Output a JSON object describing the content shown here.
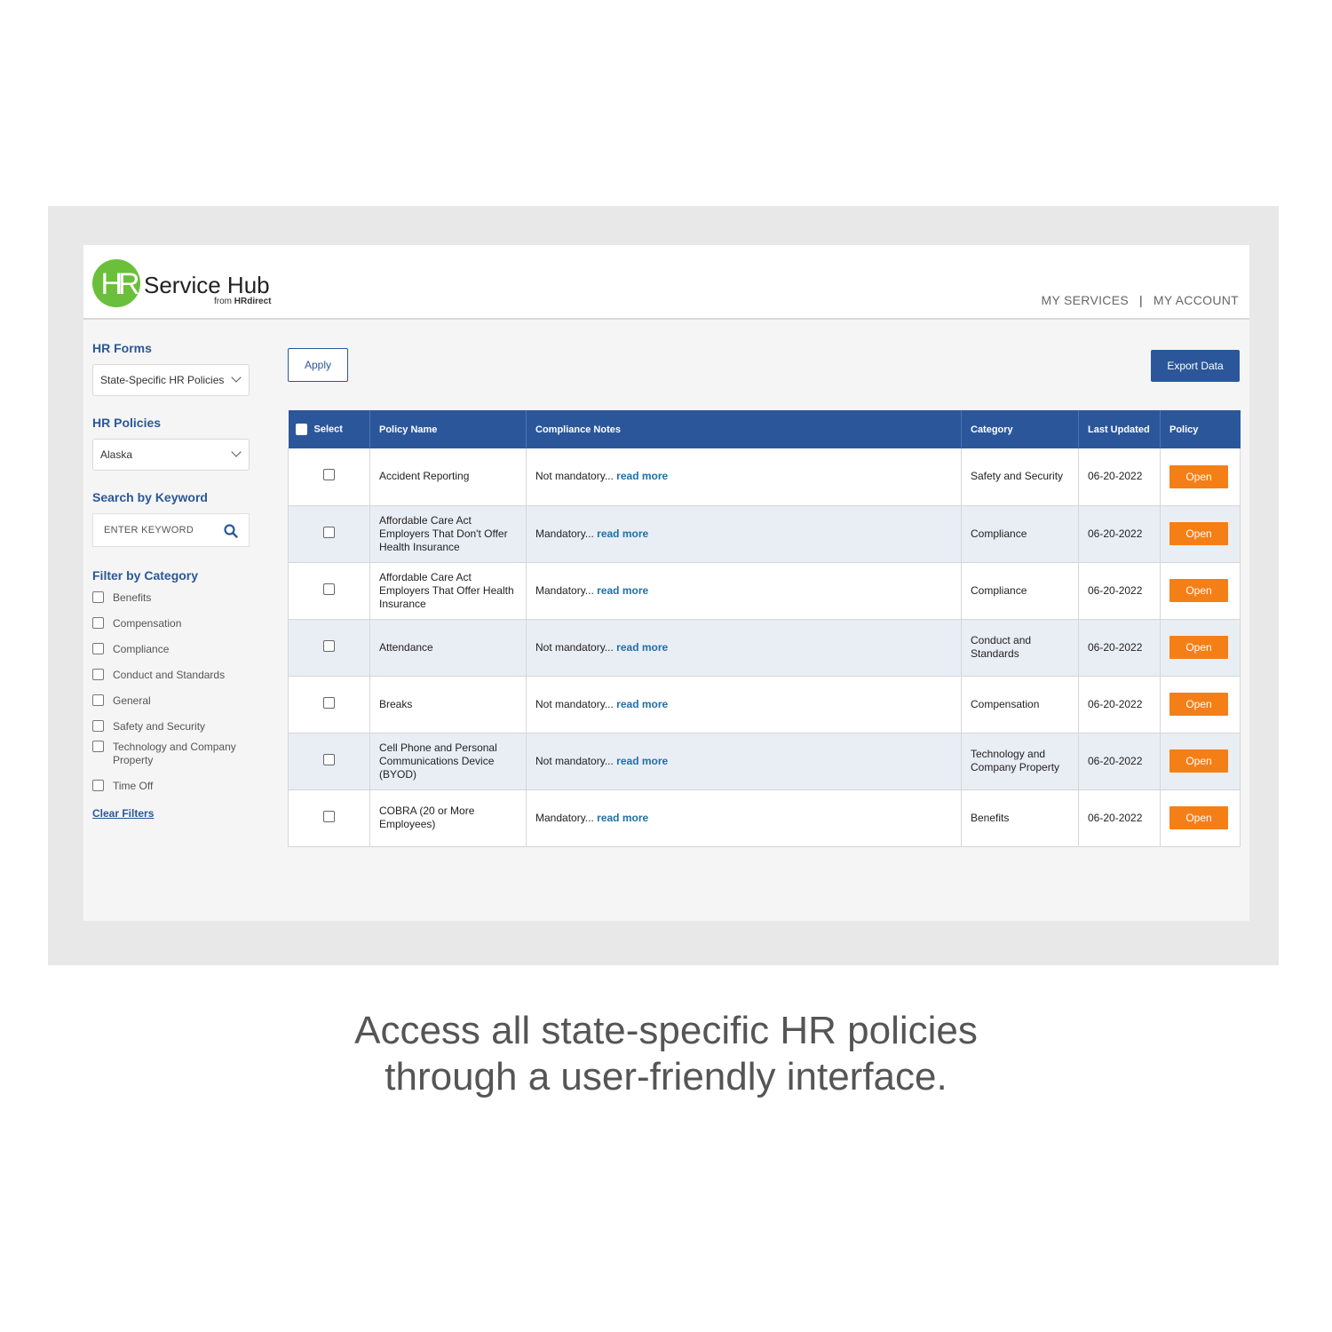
{
  "header": {
    "logo_mark": "HR",
    "logo_title": "Service Hub",
    "logo_sub_from": "from ",
    "logo_sub_brand": "HRdirect",
    "nav": [
      "MY SERVICES",
      "MY ACCOUNT"
    ],
    "nav_separator": "|"
  },
  "sidebar": {
    "hr_forms_label": "HR Forms",
    "hr_forms_value": "State-Specific HR Policies",
    "hr_policies_label": "HR Policies",
    "hr_policies_value": "Alaska",
    "search_label": "Search by Keyword",
    "search_placeholder": "ENTER KEYWORD",
    "filter_label": "Filter by Category",
    "categories": [
      "Benefits",
      "Compensation",
      "Compliance",
      "Conduct and Standards",
      "General",
      "Safety and Security",
      "Technology and Company Property",
      "Time Off"
    ],
    "clear_filters": "Clear Filters"
  },
  "toolbar": {
    "apply": "Apply",
    "export": "Export Data"
  },
  "table": {
    "columns": [
      "Select",
      "Policy Name",
      "Compliance Notes",
      "Category",
      "Last Updated",
      "Policy"
    ],
    "read_more": "read more",
    "open_label": "Open",
    "rows": [
      {
        "name": "Accident Reporting",
        "note": "Not mandatory...",
        "category": "Safety and Security",
        "updated": "06-20-2022"
      },
      {
        "name": "Affordable Care Act Employers That Don't Offer Health Insurance",
        "note": "Mandatory...",
        "category": "Compliance",
        "updated": "06-20-2022"
      },
      {
        "name": "Affordable Care Act Employers That Offer Health Insurance",
        "note": "Mandatory...",
        "category": "Compliance",
        "updated": "06-20-2022"
      },
      {
        "name": "Attendance",
        "note": "Not mandatory...",
        "category": "Conduct and Standards",
        "updated": "06-20-2022"
      },
      {
        "name": "Breaks",
        "note": "Not mandatory...",
        "category": "Compensation",
        "updated": "06-20-2022"
      },
      {
        "name": "Cell Phone and Personal Communications Device (BYOD)",
        "note": "Not mandatory...",
        "category": "Technology and Company Property",
        "updated": "06-20-2022"
      },
      {
        "name": "COBRA (20 or More Employees)",
        "note": "Mandatory...",
        "category": "Benefits",
        "updated": "06-20-2022"
      }
    ]
  },
  "caption": {
    "line1": "Access all state-specific HR policies",
    "line2": "through a user-friendly interface."
  },
  "colors": {
    "brand_green": "#6abf3b",
    "header_blue": "#2b579a",
    "open_orange": "#f57f17",
    "link_blue": "#1f6fa8"
  }
}
